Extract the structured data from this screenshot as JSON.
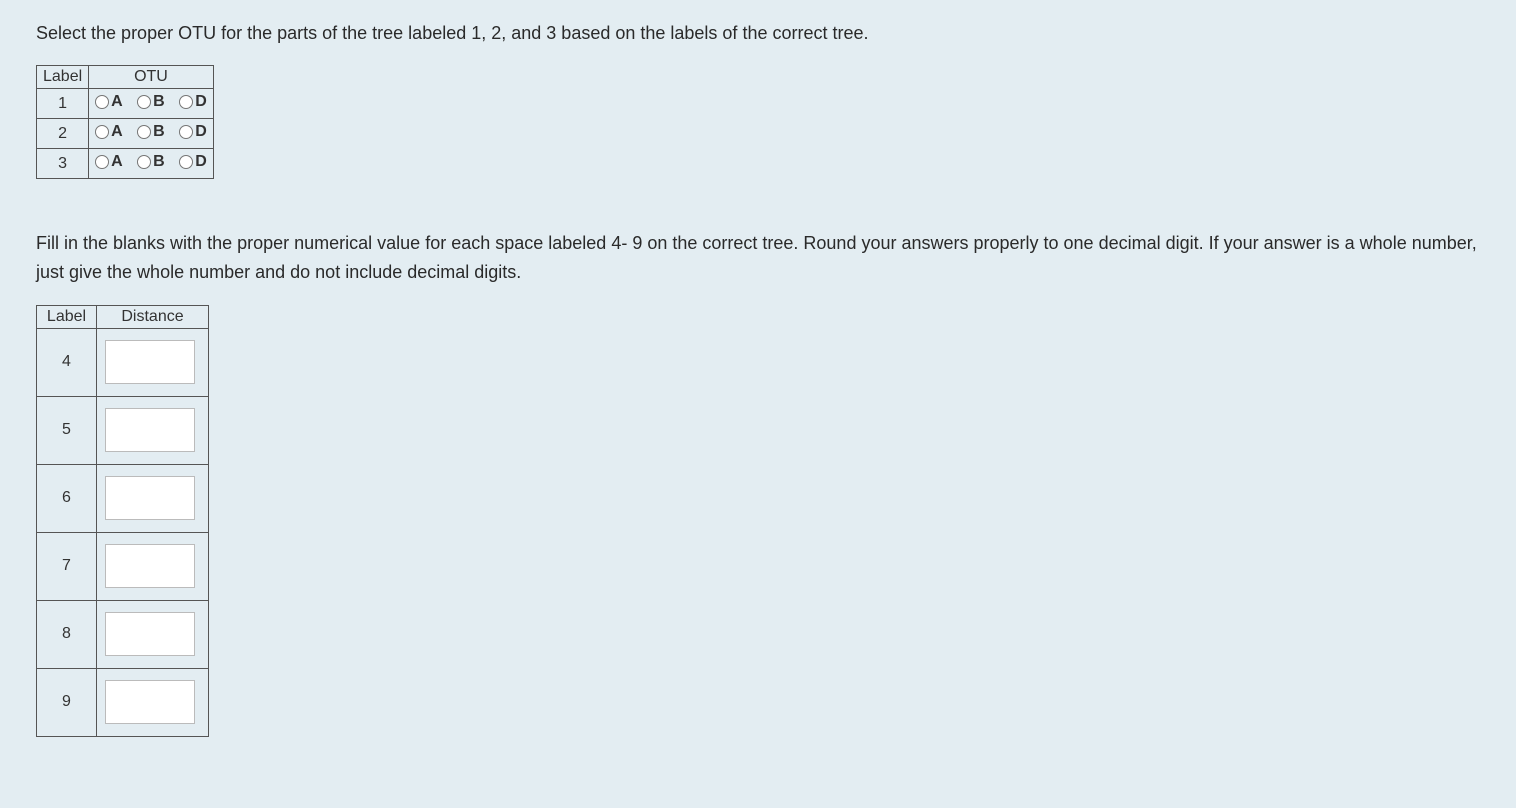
{
  "instruction1": "Select the proper OTU for the parts of the tree labeled 1, 2, and 3 based on the labels of the correct tree.",
  "instruction2": "Fill in the blanks with the proper numerical value for each space labeled 4- 9 on the correct tree. Round your answers properly to one decimal digit. If your answer is a whole number, just give the whole number and do not include decimal digits.",
  "otu_table": {
    "header_label": "Label",
    "header_otu": "OTU",
    "rows": [
      {
        "label": "1",
        "opt_a": "A",
        "opt_b": "B",
        "opt_d": "D"
      },
      {
        "label": "2",
        "opt_a": "A",
        "opt_b": "B",
        "opt_d": "D"
      },
      {
        "label": "3",
        "opt_a": "A",
        "opt_b": "B",
        "opt_d": "D"
      }
    ]
  },
  "distance_table": {
    "header_label": "Label",
    "header_distance": "Distance",
    "rows": [
      {
        "label": "4",
        "value": ""
      },
      {
        "label": "5",
        "value": ""
      },
      {
        "label": "6",
        "value": ""
      },
      {
        "label": "7",
        "value": ""
      },
      {
        "label": "8",
        "value": ""
      },
      {
        "label": "9",
        "value": ""
      }
    ]
  }
}
